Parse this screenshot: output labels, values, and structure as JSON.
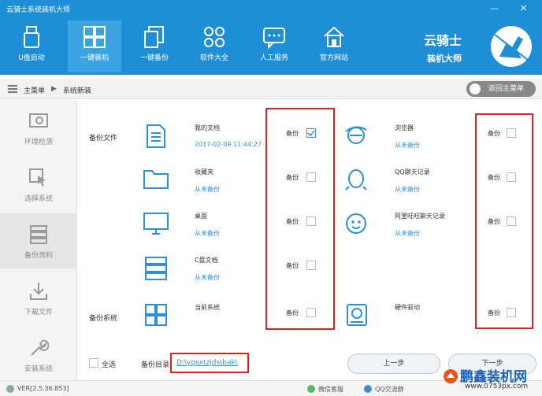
{
  "window": {
    "title": "云骑士系统装机大师",
    "min_glyph": "—",
    "close_glyph": "✕"
  },
  "nav": [
    {
      "label": "U盘启动"
    },
    {
      "label": "一键装机"
    },
    {
      "label": "一键备份"
    },
    {
      "label": "软件大全"
    },
    {
      "label": "人工服务"
    },
    {
      "label": "官方网站"
    }
  ],
  "brand": {
    "name": "云骑士",
    "sub": "装机大师"
  },
  "breadcrumb": {
    "home": "主菜单",
    "separator": "▶",
    "current": "系统新装",
    "back": "返回主菜单"
  },
  "sidebar": [
    {
      "label": "环境检测"
    },
    {
      "label": "选择系统"
    },
    {
      "label": "备份资料"
    },
    {
      "label": "下载文件"
    },
    {
      "label": "安装系统"
    }
  ],
  "sections": {
    "files": "备份文件",
    "system": "备份系统"
  },
  "backup_label": "备份",
  "left_items": [
    {
      "name": "我的文档",
      "sub": "2017-02-09 11:44:27",
      "checked": true,
      "icon": "document-icon"
    },
    {
      "name": "收藏夹",
      "sub": "从未备份",
      "checked": false,
      "icon": "folder-icon"
    },
    {
      "name": "桌面",
      "sub": "从未备份",
      "checked": false,
      "icon": "monitor-icon"
    },
    {
      "name": "C盘文档",
      "sub": "从未备份",
      "checked": false,
      "icon": "server-icon"
    },
    {
      "name": "当前系统",
      "sub": "",
      "checked": false,
      "icon": "windows-icon"
    }
  ],
  "right_items": [
    {
      "name": "浏览器",
      "sub": "从未备份",
      "checked": false,
      "icon": "ie-icon"
    },
    {
      "name": "QQ聊天记录",
      "sub": "从未备份",
      "checked": false,
      "icon": "qq-icon"
    },
    {
      "name": "阿里旺旺聊天记录",
      "sub": "从未备份",
      "checked": false,
      "icon": "wangwang-icon"
    },
    {
      "name": "硬件驱动",
      "sub": "",
      "checked": false,
      "icon": "harddisk-icon"
    }
  ],
  "footer": {
    "select_all": "全选",
    "dir_label": "备份目录：",
    "dir_path": "D:\\yqsxtzjds\\bak\\",
    "prev": "上一步",
    "next": "下一步"
  },
  "status": {
    "version": "VER[2.5.36.853]",
    "wechat": "微信客服",
    "qq": "QQ交流群"
  },
  "watermark": {
    "name": "鹏鑫装机网",
    "url": "www.0753px.com"
  },
  "colors": {
    "header": "#1e8fd6",
    "accent": "#2f8fd6",
    "highlight_box": "#e02020"
  }
}
